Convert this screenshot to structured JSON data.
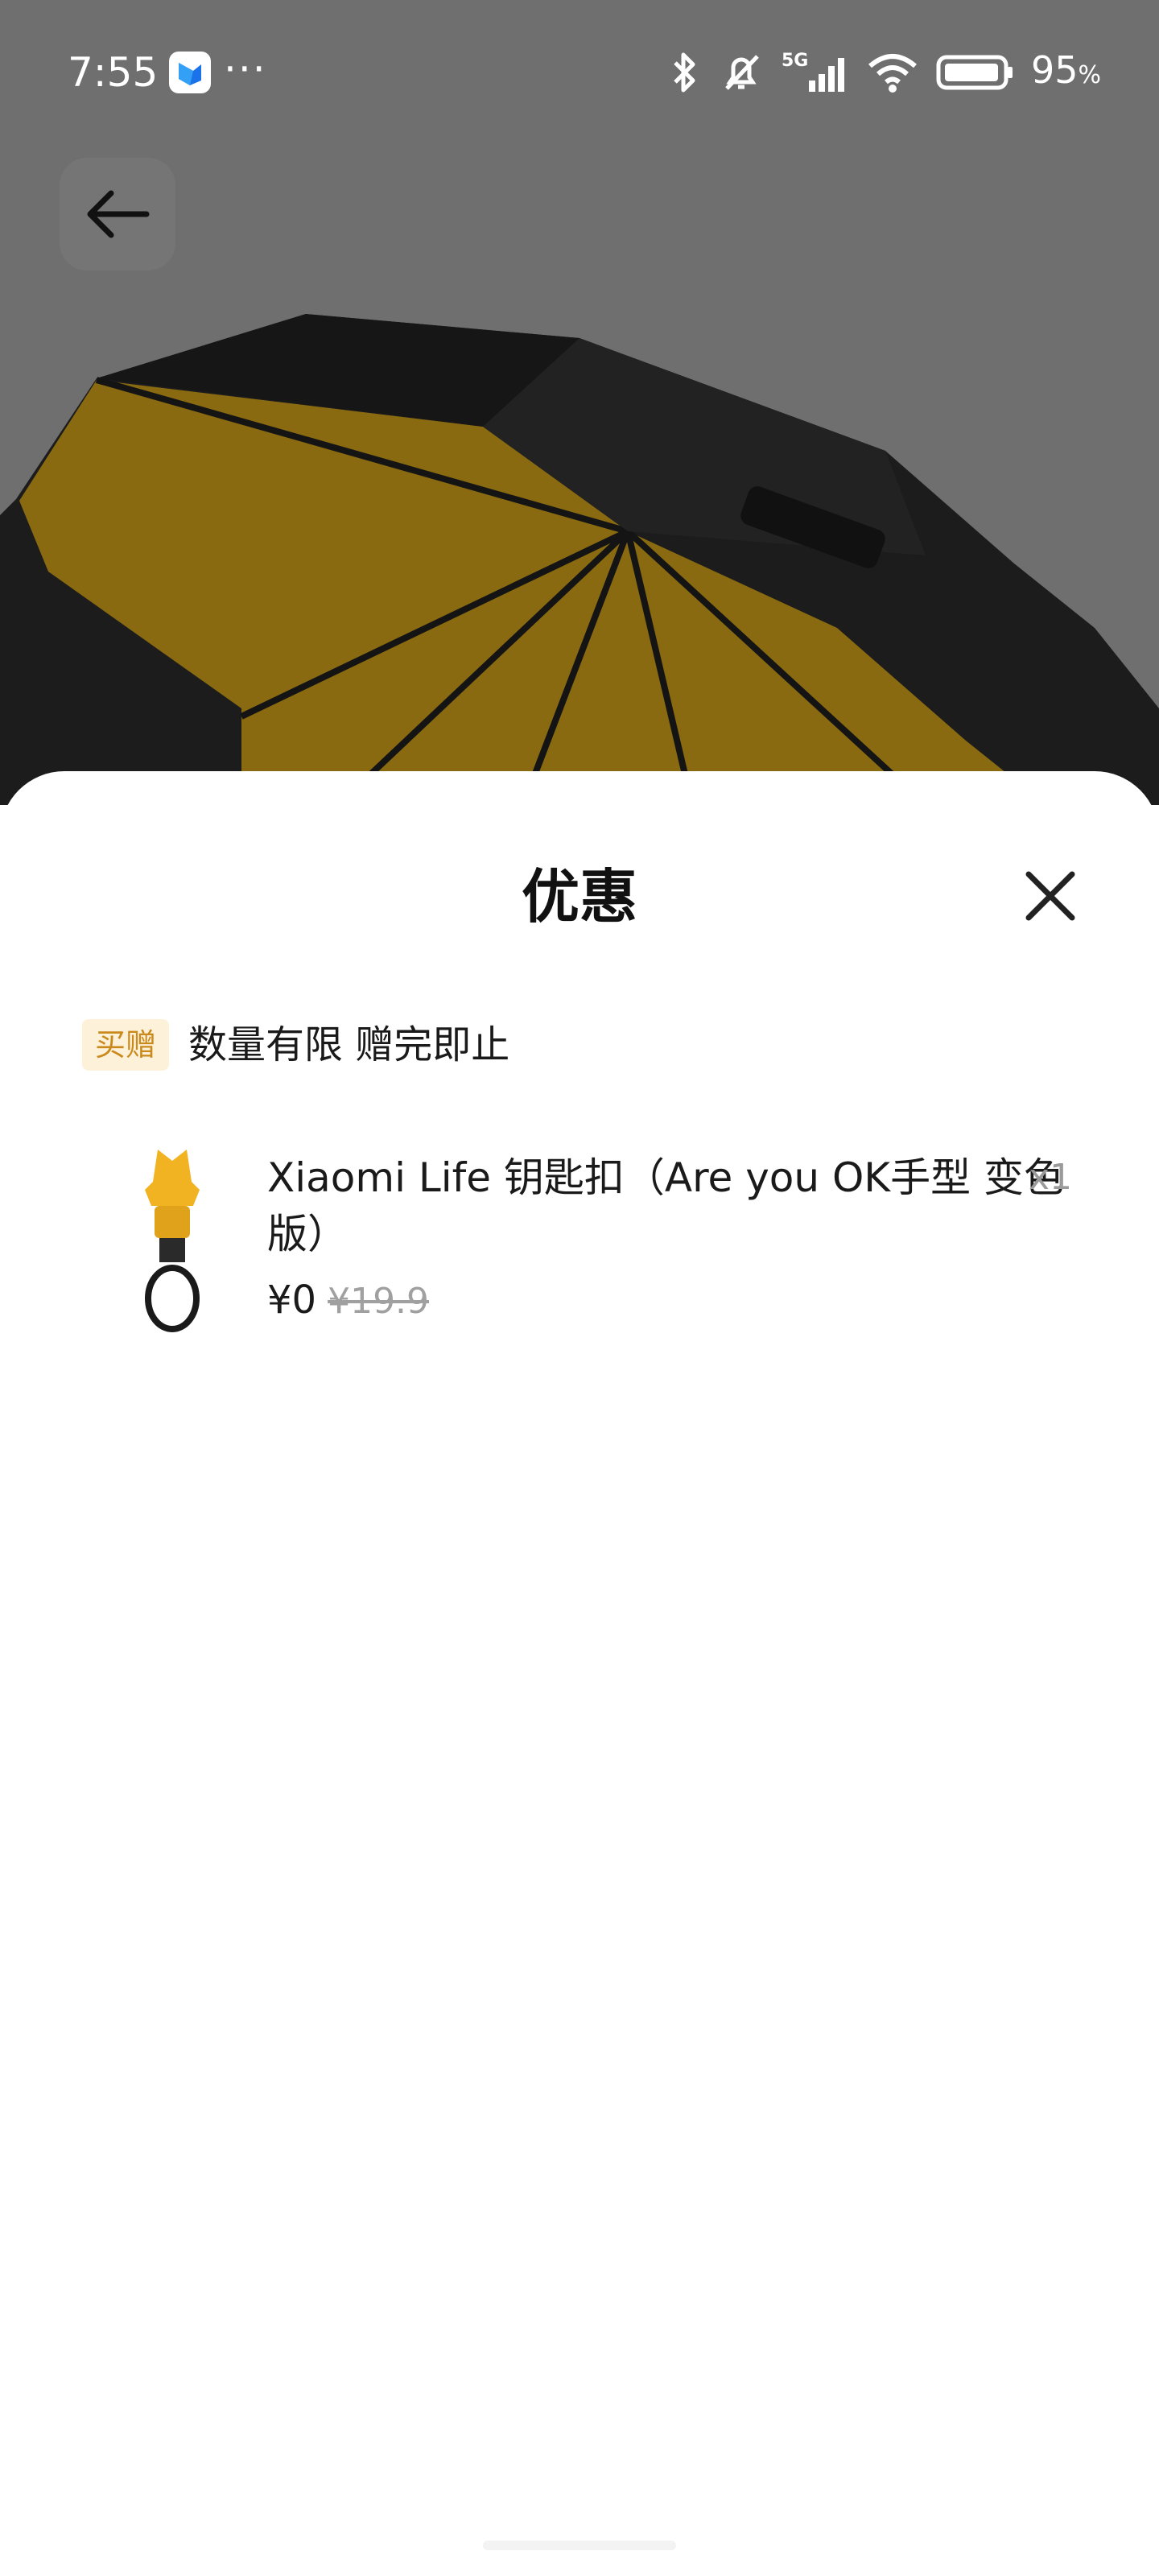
{
  "status_bar": {
    "time": "7:55",
    "more": "···",
    "network": "5G",
    "battery_value": "95",
    "battery_unit": "%"
  },
  "header": {
    "back_icon": "arrow-left-icon"
  },
  "sheet": {
    "title": "优惠",
    "close_icon": "close-icon",
    "promo_badge": "买赠",
    "promo_text": "数量有限 赠完即止",
    "gift": {
      "name": "Xiaomi Life 钥匙扣（Are you OK手型 变色版）",
      "quantity": "x1",
      "price": "¥0",
      "original_price": "¥19.9"
    }
  },
  "colors": {
    "backdrop": "#6f6f6f",
    "badge_bg": "#fdf1d9",
    "badge_text": "#c98a1b",
    "umbrella_inner": "#8a6a10",
    "umbrella_outer": "#1c1c1c"
  }
}
